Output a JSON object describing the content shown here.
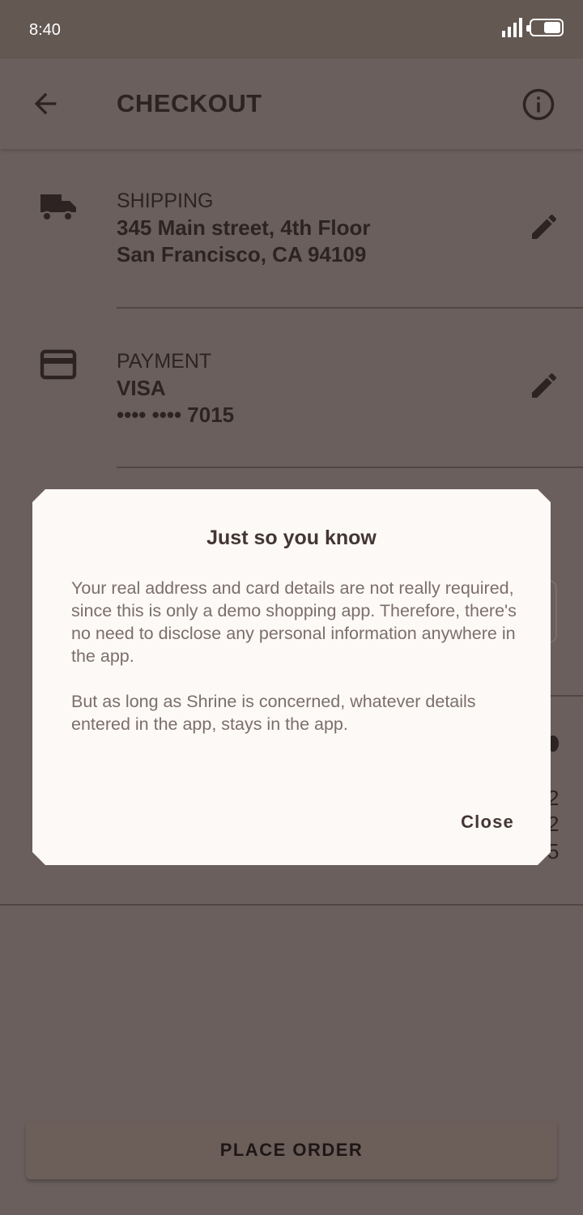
{
  "status_bar": {
    "time": "8:40"
  },
  "app_bar": {
    "title": "CHECKOUT",
    "back_icon": "arrow-back-icon",
    "info_icon": "info-icon"
  },
  "shipping": {
    "label": "SHIPPING",
    "line1": "345 Main street, 4th Floor",
    "line2": "San Francisco, CA 94109",
    "icon": "truck-icon"
  },
  "payment": {
    "label": "PAYMENT",
    "line1": "VISA",
    "line2": "•••• •••• 7015",
    "icon": "credit-card-icon"
  },
  "peek": {
    "c1": "2",
    "c2": "2",
    "c3": "5"
  },
  "dialog": {
    "title": "Just so you know",
    "paragraph1": "Your real address and card details are not really required, since this is only a demo shopping app. Therefore, there's no need to disclose any personal information anywhere in the app.",
    "paragraph2": "But as long as Shrine is concerned, whatever details entered in the app, stays in the app.",
    "close_label": "Close"
  },
  "place_order_label": "PLACE ORDER",
  "colors": {
    "scrim_background": "#6a5f5c",
    "dialog_background": "#fdf9f7",
    "text_dark": "#2d2322"
  }
}
